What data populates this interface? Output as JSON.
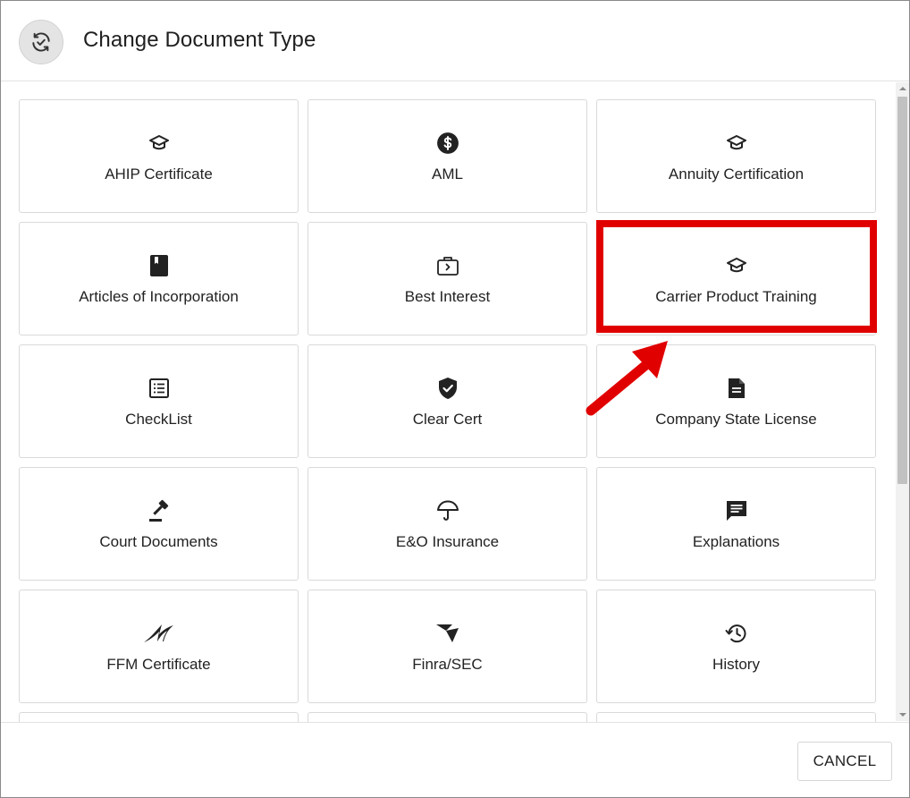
{
  "header": {
    "title": "Change Document Type",
    "icon": "sync-check-icon"
  },
  "tiles": [
    {
      "label": "AHIP Certificate",
      "icon": "graduation-cap-icon"
    },
    {
      "label": "AML",
      "icon": "dollar-circle-icon"
    },
    {
      "label": "Annuity Certification",
      "icon": "graduation-cap-icon"
    },
    {
      "label": "Articles of Incorporation",
      "icon": "book-icon"
    },
    {
      "label": "Best Interest",
      "icon": "briefcase-icon"
    },
    {
      "label": "Carrier Product Training",
      "icon": "graduation-cap-icon"
    },
    {
      "label": "CheckList",
      "icon": "checklist-icon"
    },
    {
      "label": "Clear Cert",
      "icon": "shield-check-icon"
    },
    {
      "label": "Company State License",
      "icon": "document-icon"
    },
    {
      "label": "Court Documents",
      "icon": "gavel-icon"
    },
    {
      "label": "E&O Insurance",
      "icon": "umbrella-icon"
    },
    {
      "label": "Explanations",
      "icon": "comment-icon"
    },
    {
      "label": "FFM Certificate",
      "icon": "ffm-logo-icon"
    },
    {
      "label": "Finra/SEC",
      "icon": "finra-logo-icon"
    },
    {
      "label": "History",
      "icon": "history-icon"
    }
  ],
  "annotation": {
    "highlighted_tile": "Carrier Product Training",
    "highlight_color": "#e10000"
  },
  "footer": {
    "cancel_label": "CANCEL"
  }
}
